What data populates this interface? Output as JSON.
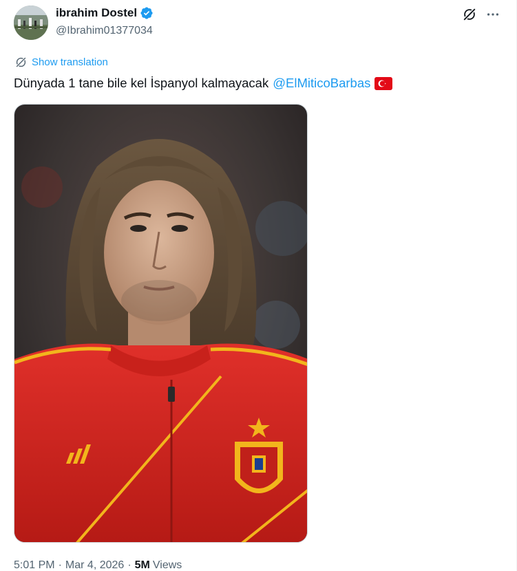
{
  "author": {
    "display_name": "ibrahim Dostel",
    "handle": "@Ibrahim01377034",
    "verified": true
  },
  "translate": {
    "label": "Show translation"
  },
  "tweet": {
    "text": "Dünyada 1 tane bile kel İspanyol kalmayacak",
    "mention": "@ElMiticoBarbas",
    "flag": "turkey-flag"
  },
  "meta": {
    "time": "5:01 PM",
    "date": "Mar 4, 2026",
    "views_count": "5M",
    "views_label": "Views"
  },
  "colors": {
    "accent": "#1d9bf0",
    "text": "#0f1419",
    "secondary": "#536471",
    "jersey_red": "#d6261e",
    "jersey_gold": "#f2b51c"
  },
  "icons": {
    "verified": "verified-badge-icon",
    "grok": "grok-icon",
    "more": "more-icon",
    "translate": "translate-globe-icon"
  }
}
